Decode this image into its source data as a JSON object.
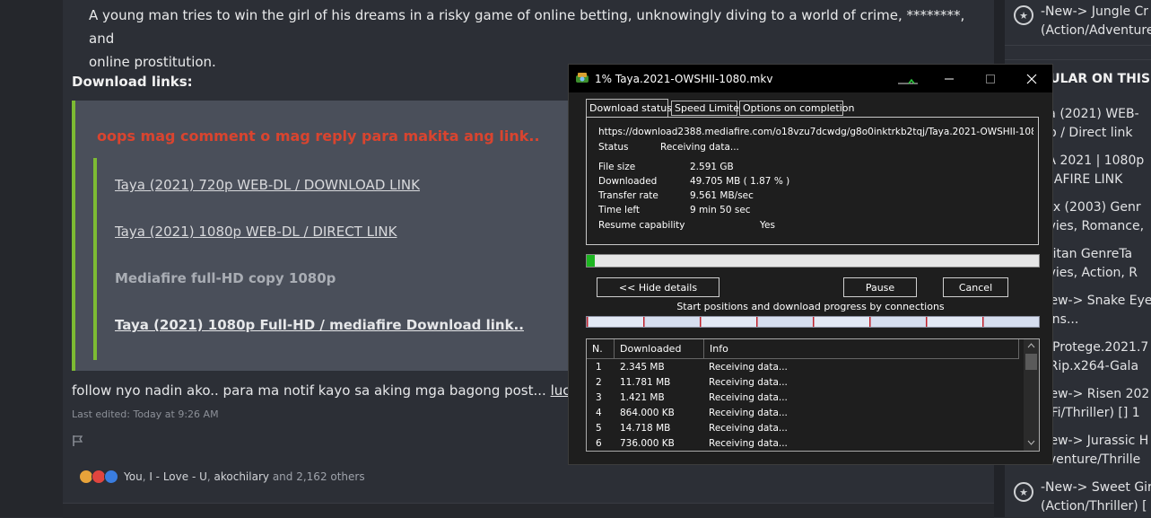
{
  "post": {
    "description_line1": "A young man tries to win the girl of his dreams in a risky game of online betting, unknowingly diving to a world of crime, ********, and",
    "description_line2": "online prostitution.",
    "download_links_heading": "Download links:",
    "quote_warning": "oops mag comment o mag reply para makita ang link..",
    "links": [
      "Taya (2021) 720p WEB-DL / DOWNLOAD LINK",
      "Taya (2021) 1080p WEB-DL / DIRECT LINK",
      "Mediafire full-HD copy 1080p",
      "Taya (2021) 1080p Full-HD / mediafire Download link.."
    ],
    "follow_text": "follow nyo nadin ako.. para ma notif kayo sa aking mga bagong post...",
    "follow_link": "lucy",
    "last_edited": "Last edited: Today at 9:26 AM",
    "reactions": {
      "users": [
        "You",
        "I - Love - U",
        "akochilary"
      ],
      "separator": ", ",
      "suffix": "and 2,162 others"
    }
  },
  "sidebar": {
    "top_item_line1": "-New-> Jungle Cr",
    "top_item_line2": "(Action/Adventure",
    "popular_heading": "PULAR ON THIS F",
    "items": [
      {
        "line1": "ya (2021) WEB-",
        "line2": "0p / Direct link"
      },
      {
        "line1": "YA 2021 | 1080p",
        "line2": "DIAFIRE LINK"
      },
      {
        "line1": "rex (2003) Genr",
        "line2": "ovies, Romance,"
      },
      {
        "line1": "mitan GenreTa",
        "line2": "ovies, Action, R"
      },
      {
        "line1": "New-> Snake Eye",
        "line2": "gins..."
      },
      {
        "line1": "e.Protege.2021.7",
        "line2": "BRip.x264-Gala"
      },
      {
        "line1": "New-> Risen 202",
        "line2": "ciFi/Thriller) [] 1"
      },
      {
        "line1": "New-> Jurassic H",
        "line2": "dventure/Thrille"
      }
    ],
    "bottom_item_line1": "-New-> Sweet Gir",
    "bottom_item_line2": "(Action/Thriller) ["
  },
  "idm": {
    "title": "1% Taya.2021-OWSHII-1080.mkv",
    "tabs": [
      "Download status",
      "Speed Limiter",
      "Options on completion"
    ],
    "url": "https://download2388.mediafire.com/o18vzu7dcwdg/g8o0inktrkb2tqj/Taya.2021-OWSHII-1080.mk",
    "status_label": "Status",
    "status_value": "Receiving data...",
    "file_size_label": "File size",
    "file_size_value": "2.591  GB",
    "downloaded_label": "Downloaded",
    "downloaded_value": "49.705  MB  ( 1.87 % )",
    "transfer_rate_label": "Transfer rate",
    "transfer_rate_value": "9.561  MB/sec",
    "time_left_label": "Time left",
    "time_left_value": "9 min 50 sec",
    "resume_label": "Resume capability",
    "resume_value": "Yes",
    "progress_fraction": 0.0187,
    "hide_details_label": "<< Hide details",
    "pause_label": "Pause",
    "cancel_label": "Cancel",
    "connections_label": "Start positions and download progress by connections",
    "table_headers": [
      "N.",
      "Downloaded",
      "Info"
    ],
    "connections": [
      {
        "n": "1",
        "downloaded": "2.345  MB",
        "info": "Receiving data..."
      },
      {
        "n": "2",
        "downloaded": "11.781  MB",
        "info": "Receiving data..."
      },
      {
        "n": "3",
        "downloaded": "1.421  MB",
        "info": "Receiving data..."
      },
      {
        "n": "4",
        "downloaded": "864.000  KB",
        "info": "Receiving data..."
      },
      {
        "n": "5",
        "downloaded": "14.718  MB",
        "info": "Receiving data..."
      },
      {
        "n": "6",
        "downloaded": "736.000  KB",
        "info": "Receiving data..."
      }
    ],
    "colors": {
      "progress": "#1db521",
      "connection_marker": "#c0202a"
    }
  }
}
